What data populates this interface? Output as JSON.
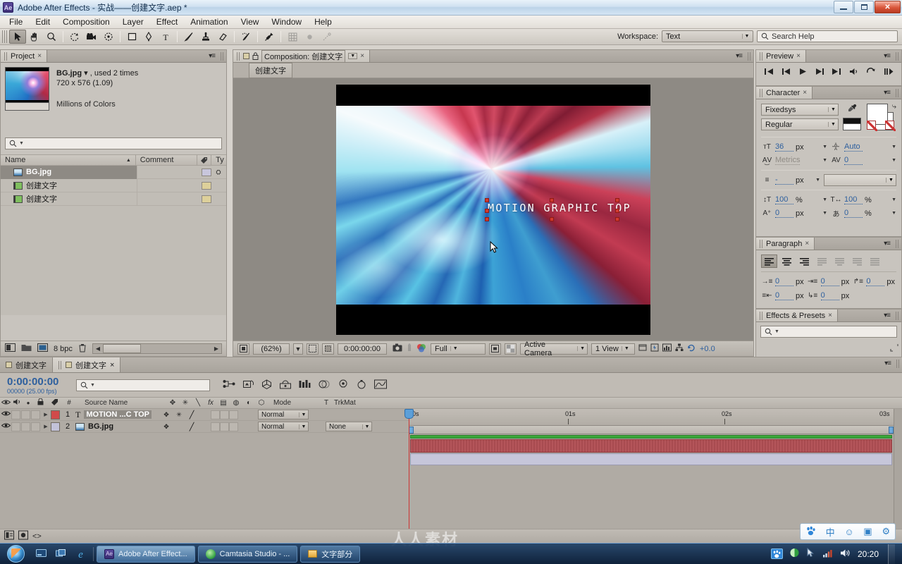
{
  "window": {
    "title": "Adobe After Effects - 实战——创建文字.aep *",
    "app_badge": "Ae",
    "minimize": "—",
    "maximize": "□",
    "close": "✕"
  },
  "menubar": {
    "items": [
      "File",
      "Edit",
      "Composition",
      "Layer",
      "Effect",
      "Animation",
      "View",
      "Window",
      "Help"
    ]
  },
  "toolbar": {
    "tools": [
      {
        "name": "selection-tool",
        "glyph": "➤"
      },
      {
        "name": "hand-tool",
        "glyph": "✋"
      },
      {
        "name": "zoom-tool",
        "glyph": "🔍"
      },
      {
        "name": "rotation-tool",
        "glyph": "↻"
      },
      {
        "name": "camera-tool",
        "glyph": "🎥"
      },
      {
        "name": "pan-behind-tool",
        "glyph": "✥"
      },
      {
        "name": "shape-tool",
        "glyph": "▭"
      },
      {
        "name": "pen-tool",
        "glyph": "✒"
      },
      {
        "name": "type-tool",
        "glyph": "T"
      },
      {
        "name": "brush-tool",
        "glyph": "🖌"
      },
      {
        "name": "clone-stamp-tool",
        "glyph": "⎈"
      },
      {
        "name": "eraser-tool",
        "glyph": "▱"
      },
      {
        "name": "roto-brush-tool",
        "glyph": "🖉"
      },
      {
        "name": "puppet-pin-tool",
        "glyph": "📌"
      }
    ],
    "workspace_label": "Workspace:",
    "workspace_value": "Text",
    "search_help_placeholder": "Search Help"
  },
  "project_panel": {
    "tab": "Project",
    "close": "×",
    "file_title": "BG.jpg",
    "file_used": ", used 2 times",
    "file_dimensions": "720 x 576 (1.09)",
    "file_colors": "Millions of Colors",
    "search_placeholder": "",
    "columns": [
      "Name",
      "Comment",
      "Ty"
    ],
    "items": [
      {
        "name": "BG.jpg",
        "icon": "image-icon",
        "selected": true
      },
      {
        "name": "创建文字",
        "icon": "composition-icon",
        "selected": false
      },
      {
        "name": "创建文字",
        "icon": "composition-icon",
        "selected": false
      }
    ],
    "footer_bpc": "8 bpc"
  },
  "composition_panel": {
    "tab": "Composition: 创建文字",
    "close": "×",
    "breadcrumb": "创建文字",
    "canvas_text": "MOTION GRAPHIC TOP",
    "zoom": "(62%)",
    "timecode": "0:00:00:00",
    "resolution": "Full",
    "camera": "Active Camera",
    "views": "1 View",
    "exposure": "+0.0"
  },
  "preview_panel": {
    "tab": "Preview",
    "close": "×",
    "buttons": [
      "first-frame",
      "prev-frame",
      "play",
      "next-frame",
      "last-frame",
      "audio",
      "loop",
      "ram-preview"
    ]
  },
  "character_panel": {
    "tab": "Character",
    "close": "×",
    "font_family": "Fixedsys",
    "font_style": "Regular",
    "font_size": "36",
    "font_size_unit": "px",
    "leading": "Auto",
    "kerning": "Metrics",
    "tracking": "0",
    "stroke_width": "-",
    "stroke_width_unit": "px",
    "vertical_scale": "100",
    "vertical_scale_unit": "%",
    "horizontal_scale": "100",
    "horizontal_scale_unit": "%",
    "baseline_shift": "0",
    "baseline_shift_unit": "px",
    "tsume": "0",
    "tsume_unit": "%"
  },
  "paragraph_panel": {
    "tab": "Paragraph",
    "close": "×",
    "indent_left": "0",
    "indent_right": "0",
    "indent_first": "0",
    "space_before": "0",
    "space_after": "0",
    "unit": "px"
  },
  "effects_panel": {
    "tab": "Effects & Presets",
    "close": "×",
    "search_placeholder": ""
  },
  "timeline": {
    "tabs": [
      {
        "label": "创建文字",
        "active": false
      },
      {
        "label": "创建文字",
        "active": true
      }
    ],
    "close": "×",
    "current_time": "0:00:00:00",
    "frame_info": "00000 (25.00 fps)",
    "search_placeholder": "",
    "columns": {
      "source_name": "Source Name",
      "mode": "Mode",
      "t": "T",
      "trkmat": "TrkMat",
      "num": "#"
    },
    "layers": [
      {
        "number": "1",
        "type_icon": "text-layer-icon",
        "name": "MOTION ...C TOP",
        "mode": "Normal",
        "trkmat": "",
        "color": "#d14a4a",
        "bar_color": "#b4555a"
      },
      {
        "number": "2",
        "type_icon": "image-layer-icon",
        "name": "BG.jpg",
        "mode": "Normal",
        "trkmat": "None",
        "color": "#c2c2d8",
        "bar_color": "#c6c6da"
      }
    ],
    "ruler_labels": [
      "0s",
      "01s",
      "02s",
      "03s"
    ]
  },
  "watermark": "人人素材",
  "ime_bar": {
    "items": [
      "baidu-paw-icon",
      "中",
      "☺",
      "▣",
      "⚙"
    ]
  },
  "taskbar": {
    "quick_launch": [
      "show-desktop-icon",
      "switcher-icon",
      "internet-explorer-icon"
    ],
    "buttons": [
      {
        "label": "Adobe After Effect...",
        "icon": "ae-icon",
        "active": true
      },
      {
        "label": "Camtasia Studio - ...",
        "icon": "camtasia-icon",
        "active": false
      },
      {
        "label": "文字部分",
        "icon": "folder-icon",
        "active": false
      }
    ],
    "tray": [
      "baidu-icon",
      "camtasia-tray-icon",
      "pointer-icon",
      "network-icon",
      "volume-icon"
    ],
    "clock": "20:20"
  }
}
